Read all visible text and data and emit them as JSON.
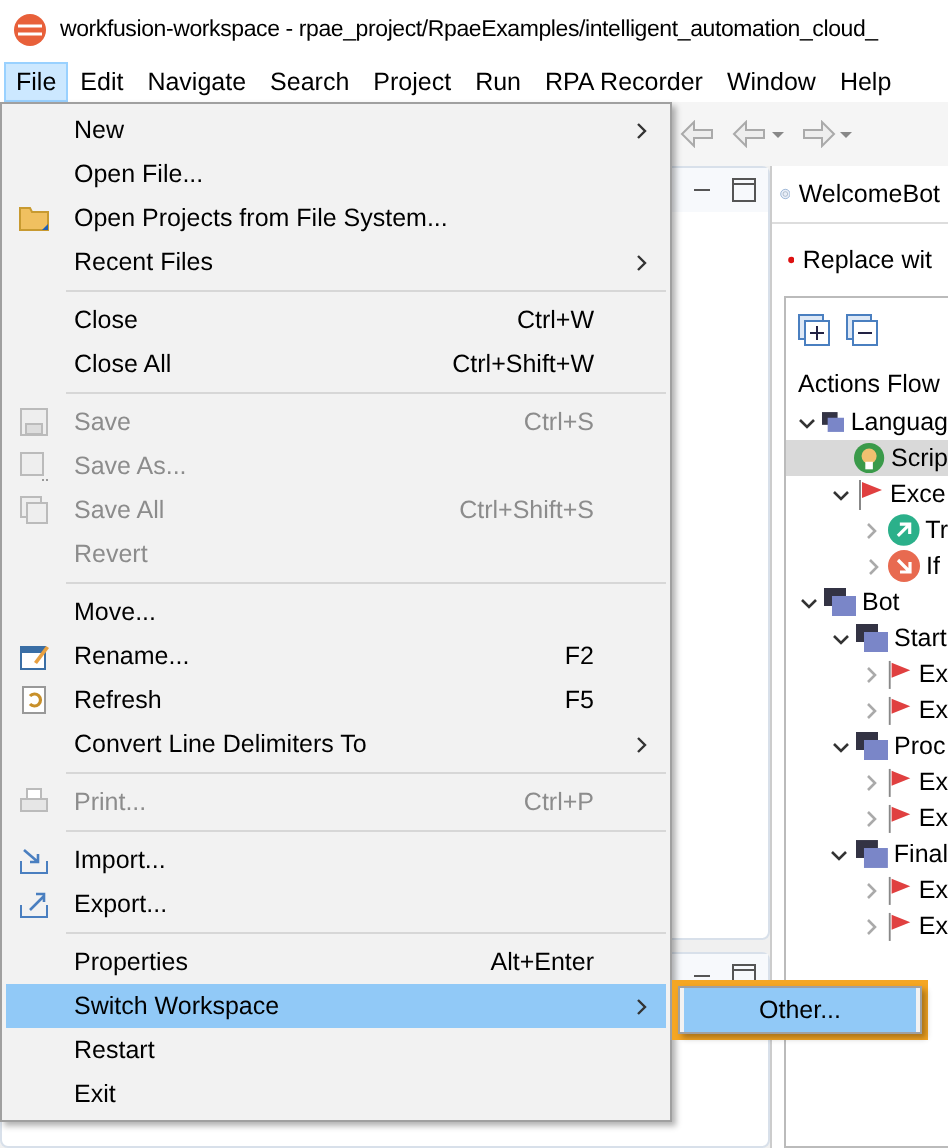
{
  "window": {
    "title": "workfusion-workspace - rpae_project/RpaeExamples/intelligent_automation_cloud_"
  },
  "menubar": [
    {
      "label": "File",
      "selected": true
    },
    {
      "label": "Edit",
      "selected": false
    },
    {
      "label": "Navigate",
      "selected": false
    },
    {
      "label": "Search",
      "selected": false
    },
    {
      "label": "Project",
      "selected": false
    },
    {
      "label": "Run",
      "selected": false
    },
    {
      "label": "RPA Recorder",
      "selected": false
    },
    {
      "label": "Window",
      "selected": false
    },
    {
      "label": "Help",
      "selected": false
    }
  ],
  "file_menu": [
    {
      "kind": "item",
      "label": "New",
      "submenu": true,
      "disabled": false,
      "selected": false
    },
    {
      "kind": "item",
      "label": "Open File...",
      "disabled": false,
      "selected": false
    },
    {
      "kind": "item",
      "label": "Open Projects from File System...",
      "disabled": false,
      "selected": false
    },
    {
      "kind": "item",
      "label": "Recent Files",
      "submenu": true,
      "disabled": false,
      "selected": false
    },
    {
      "kind": "separator"
    },
    {
      "kind": "item",
      "label": "Close",
      "shortcut": "Ctrl+W",
      "disabled": false,
      "selected": false
    },
    {
      "kind": "item",
      "label": "Close All",
      "shortcut": "Ctrl+Shift+W",
      "disabled": false,
      "selected": false
    },
    {
      "kind": "separator"
    },
    {
      "kind": "item",
      "label": "Save",
      "shortcut": "Ctrl+S",
      "disabled": true,
      "selected": false
    },
    {
      "kind": "item",
      "label": "Save As...",
      "disabled": true,
      "selected": false
    },
    {
      "kind": "item",
      "label": "Save All",
      "shortcut": "Ctrl+Shift+S",
      "disabled": true,
      "selected": false
    },
    {
      "kind": "item",
      "label": "Revert",
      "disabled": true,
      "selected": false
    },
    {
      "kind": "separator"
    },
    {
      "kind": "item",
      "label": "Move...",
      "disabled": false,
      "selected": false
    },
    {
      "kind": "item",
      "label": "Rename...",
      "shortcut": "F2",
      "disabled": false,
      "selected": false
    },
    {
      "kind": "item",
      "label": "Refresh",
      "shortcut": "F5",
      "disabled": false,
      "selected": false
    },
    {
      "kind": "item",
      "label": "Convert Line Delimiters To",
      "submenu": true,
      "disabled": false,
      "selected": false
    },
    {
      "kind": "separator"
    },
    {
      "kind": "item",
      "label": "Print...",
      "shortcut": "Ctrl+P",
      "disabled": true,
      "selected": false
    },
    {
      "kind": "separator"
    },
    {
      "kind": "item",
      "label": "Import...",
      "disabled": false,
      "selected": false
    },
    {
      "kind": "item",
      "label": "Export...",
      "disabled": false,
      "selected": false
    },
    {
      "kind": "separator"
    },
    {
      "kind": "item",
      "label": "Properties",
      "shortcut": "Alt+Enter",
      "disabled": false,
      "selected": false
    },
    {
      "kind": "item",
      "label": "Switch Workspace",
      "submenu": true,
      "disabled": false,
      "selected": true
    },
    {
      "kind": "item",
      "label": "Restart",
      "disabled": false,
      "selected": false
    },
    {
      "kind": "item",
      "label": "Exit",
      "disabled": false,
      "selected": false
    }
  ],
  "switch_submenu": {
    "highlighted": true,
    "items": [
      {
        "label": "Other...",
        "selected": true
      }
    ]
  },
  "editor": {
    "tab": "WelcomeBot",
    "notice": "Replace wit",
    "heading": "Actions Flow",
    "tree": [
      {
        "kind": "group",
        "label": "Languag",
        "expanded": true,
        "selected": false,
        "children": [
          {
            "kind": "script",
            "label": "Scrip",
            "selected": true
          },
          {
            "kind": "flag",
            "label": "Exce",
            "expanded": true,
            "selected": false,
            "children": [
              {
                "kind": "up",
                "label": "Tr",
                "expanded": false,
                "selected": false
              },
              {
                "kind": "down",
                "label": "If",
                "expanded": false,
                "selected": false
              }
            ]
          }
        ]
      },
      {
        "kind": "group",
        "label": "Bot",
        "expanded": true,
        "selected": false,
        "children": [
          {
            "kind": "group",
            "label": "Start",
            "expanded": true,
            "selected": false,
            "children": [
              {
                "kind": "flag",
                "label": "Ex",
                "expanded": false,
                "selected": false
              },
              {
                "kind": "flag",
                "label": "Ex",
                "expanded": false,
                "selected": false
              }
            ]
          },
          {
            "kind": "group",
            "label": "Proc",
            "expanded": true,
            "selected": false,
            "children": [
              {
                "kind": "flag",
                "label": "Ex",
                "expanded": false,
                "selected": false
              },
              {
                "kind": "flag",
                "label": "Ex",
                "expanded": false,
                "selected": false
              }
            ]
          },
          {
            "kind": "group",
            "label": "Final",
            "expanded": true,
            "selected": false,
            "children": [
              {
                "kind": "flag",
                "label": "Ex",
                "expanded": false,
                "selected": false
              },
              {
                "kind": "flag",
                "label": "Ex",
                "expanded": false,
                "selected": false
              }
            ]
          }
        ]
      }
    ]
  }
}
